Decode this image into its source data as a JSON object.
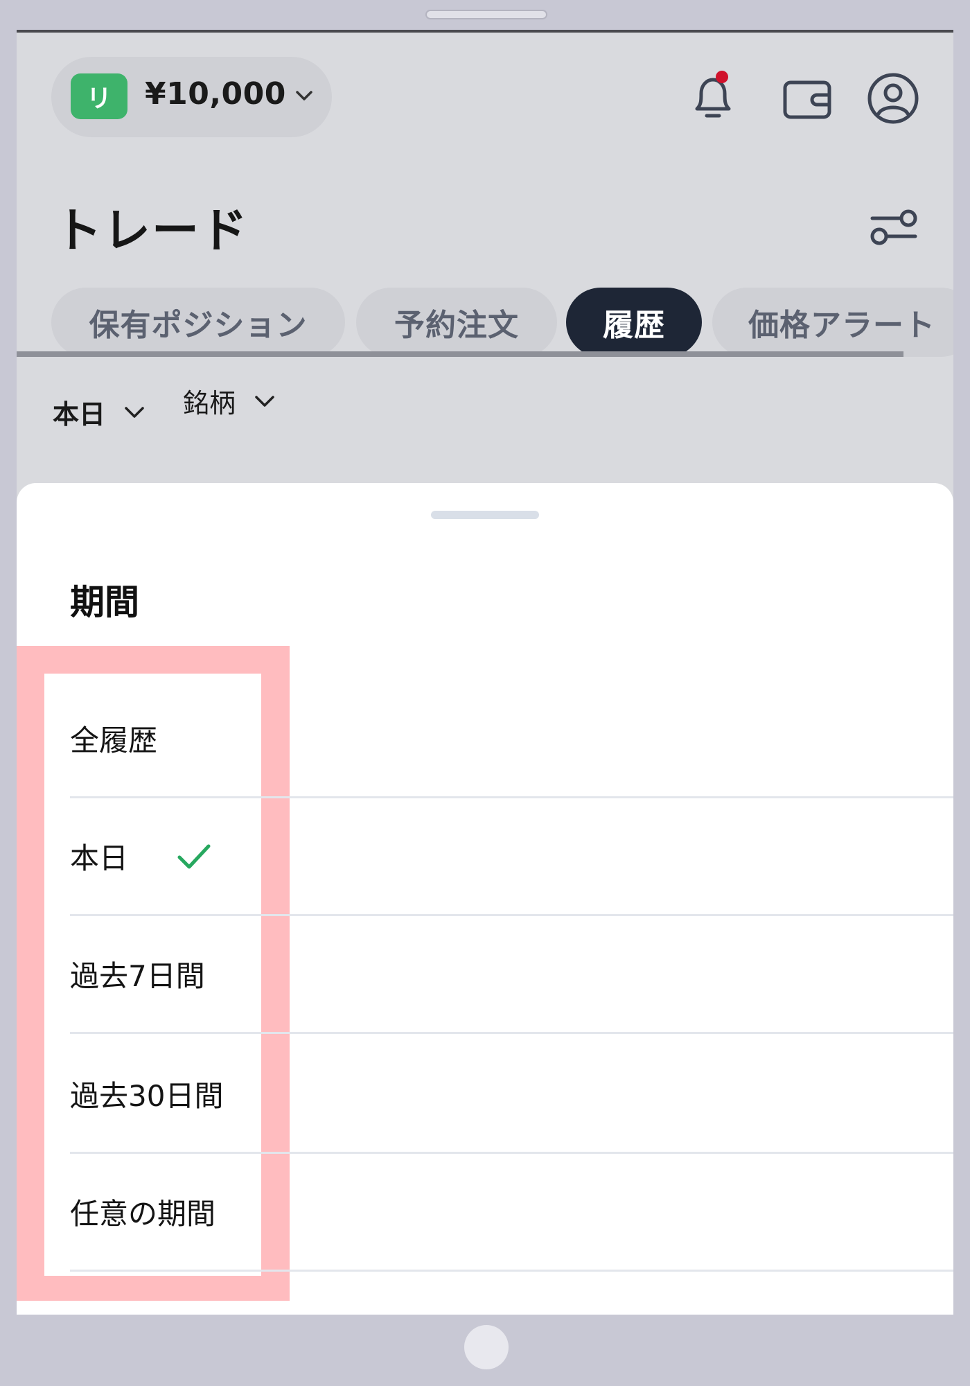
{
  "header": {
    "account_badge": "リ",
    "balance": "¥10,000",
    "balance_chevron_icon": "chevron-down-icon",
    "icons": [
      "bell-icon",
      "wallet-icon",
      "user-icon"
    ],
    "notification_dot_color": "#d0112b"
  },
  "page": {
    "title": "トレード",
    "settings_icon": "sliders-icon"
  },
  "tabs": [
    {
      "label": "保有ポジション",
      "active": false
    },
    {
      "label": "予約注文",
      "active": false
    },
    {
      "label": "履歴",
      "active": true
    },
    {
      "label": "価格アラート",
      "active": false
    }
  ],
  "filters": {
    "period": "本日",
    "symbol": "銘柄"
  },
  "sheet": {
    "title": "期間",
    "options": [
      {
        "label": "全履歴",
        "selected": false
      },
      {
        "label": "本日",
        "selected": true
      },
      {
        "label": "過去7日間",
        "selected": false
      },
      {
        "label": "過去30日間",
        "selected": false
      },
      {
        "label": "任意の期間",
        "selected": false
      }
    ]
  },
  "colors": {
    "accent_green": "#3eb36b",
    "active_tab": "#1e2636",
    "highlight": "#ffbcbf"
  }
}
